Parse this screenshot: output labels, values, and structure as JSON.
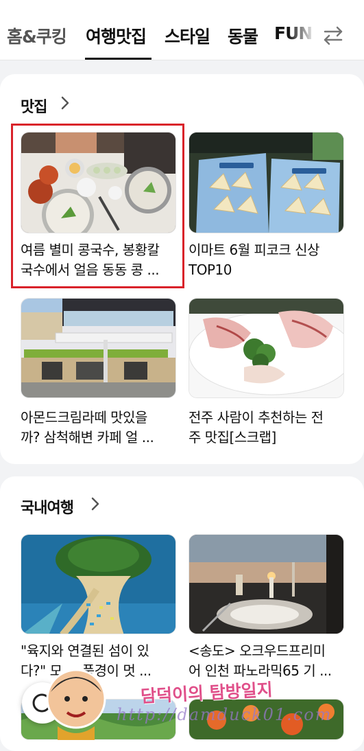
{
  "tabs": [
    {
      "label": "홈&쿠킹"
    },
    {
      "label": "여행맛집"
    },
    {
      "label": "스타일"
    },
    {
      "label": "동물"
    },
    {
      "label": "FUN"
    }
  ],
  "sections": [
    {
      "title": "맛집",
      "items": [
        {
          "caption_line1": "여름 별미 콩국수, 봉황칼",
          "caption_line2": "국수에서 얼음 동동 콩 ..."
        },
        {
          "caption_line1": "이마트 6월 피코크 신상",
          "caption_line2": "TOP10"
        },
        {
          "caption_line1": "아몬드크림라떼 맛있을",
          "caption_line2": "까? 삼척해변 카페 얼 ..."
        },
        {
          "caption_line1": "전주 사람이 추천하는 전",
          "caption_line2": "주 맛집[스크랩]"
        }
      ]
    },
    {
      "title": "국내여행",
      "items": [
        {
          "caption_line1": "\"육지와 연결된 섬이 있",
          "caption_line2": "다?\" 모 ... 풍경이 멋 ..."
        },
        {
          "caption_line1": "<송도> 오크우드프리미",
          "caption_line2": "어 인천 파노라믹65 기 ..."
        }
      ]
    }
  ],
  "watermark": {
    "name": "담덕이의 탐방일지",
    "url": "http://damduck01.com"
  },
  "colors": {
    "highlight": "#d9222a",
    "tab_active": "#111111",
    "background": "#f2f3f5"
  },
  "icons": {
    "swap": "swap-arrows-icon",
    "chevron": "chevron-right-icon"
  }
}
